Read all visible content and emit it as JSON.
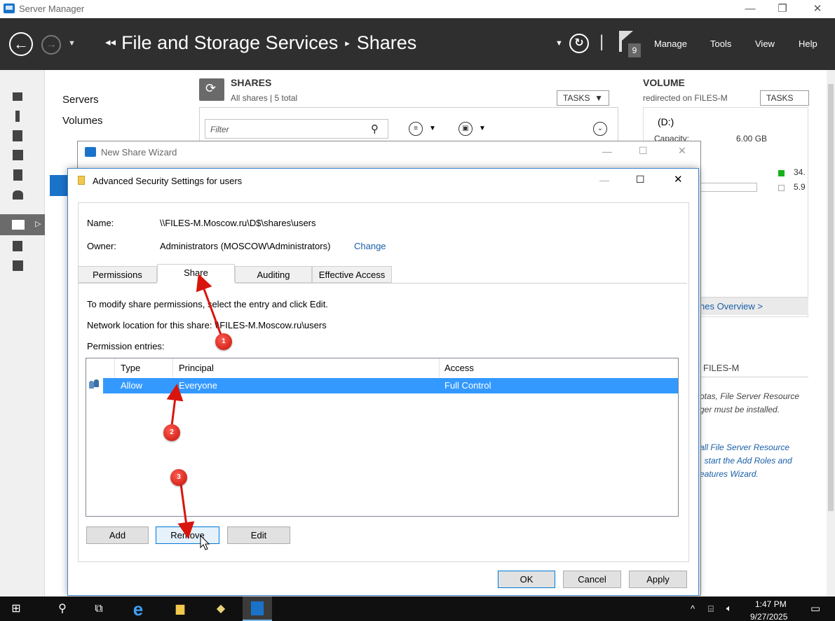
{
  "server_manager": {
    "title": "Server Manager",
    "breadcrumb_root": "File and Storage Services",
    "breadcrumb_page": "Shares",
    "flag_count": "9",
    "menu": [
      "Manage",
      "Tools",
      "View",
      "Help"
    ],
    "nav_items": [
      "Servers",
      "Volumes"
    ],
    "shares": {
      "title": "SHARES",
      "subtitle": "All shares | 5 total",
      "tasks": "TASKS",
      "filter_placeholder": "Filter"
    },
    "volume": {
      "title": "VOLUME",
      "subtitle": "redirected on FILES-M",
      "tasks": "TASKS",
      "drive": "(D:)",
      "capacity_label": "Capacity:",
      "capacity_value": "6.00 GB",
      "legend_used": "34.",
      "legend_free": "5.9",
      "overview_link": "nes Overview >",
      "fsrm_title": "FILES-M",
      "fsrm_text_1": "otas, File Server Resource",
      "fsrm_text_2": "ger must be installed.",
      "fsrm_link_1": "all File Server Resource",
      "fsrm_link_2": ", start the Add Roles and",
      "fsrm_link_3": "eatures Wizard."
    }
  },
  "wizard": {
    "title": "New Share Wizard"
  },
  "advanced_security": {
    "title": "Advanced Security Settings for users",
    "name_label": "Name:",
    "name_value": "\\\\FILES-M.Moscow.ru\\D$\\shares\\users",
    "owner_label": "Owner:",
    "owner_value": "Administrators (MOSCOW\\Administrators)",
    "owner_change": "Change",
    "tabs": [
      "Permissions",
      "Share",
      "Auditing",
      "Effective Access"
    ],
    "active_tab": "Share",
    "instruction": "To modify share permissions, select the entry and click Edit.",
    "network_location": "Network location for this share:  \\\\FILES-M.Moscow.ru\\users",
    "entries_label": "Permission entries:",
    "columns": [
      "Type",
      "Principal",
      "Access"
    ],
    "rows": [
      {
        "type": "Allow",
        "principal": "Everyone",
        "access": "Full Control"
      }
    ],
    "buttons": {
      "add": "Add",
      "remove": "Remove",
      "edit": "Edit",
      "ok": "OK",
      "cancel": "Cancel",
      "apply": "Apply"
    }
  },
  "annotations": [
    "1",
    "2",
    "3"
  ],
  "taskbar": {
    "time": "1:47 PM",
    "date": "9/27/2025"
  },
  "colors": {
    "accent": "#1a73c9",
    "selection": "#3399ff",
    "header_bg": "#2f2f2f",
    "annotation_red": "#d8150c"
  }
}
